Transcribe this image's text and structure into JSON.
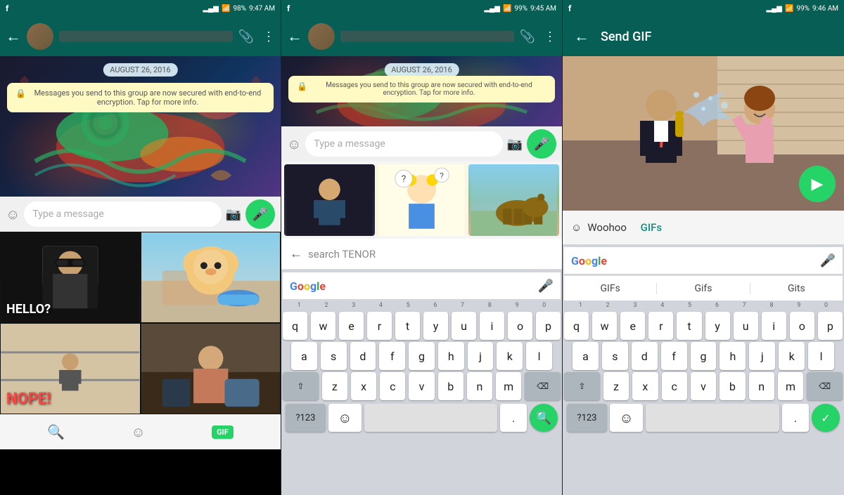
{
  "panels": [
    {
      "id": "panel1",
      "status": {
        "left": "f",
        "time": "9:47 AM",
        "battery": "98%",
        "signal": "▂▄▆"
      },
      "toolbar": {
        "back": "",
        "contact_name_placeholder": "████████████"
      },
      "chat": {
        "date_badge": "AUGUST 26, 2016",
        "system_message": "🔒 Messages you send to this group are now secured with end-to-end encryption. Tap for more info."
      },
      "input": {
        "placeholder": "Type a message"
      },
      "gif_cells": [
        {
          "label": "HELLO?",
          "style": "dark-man"
        },
        {
          "label": "",
          "style": "pom"
        },
        {
          "label": "NOPE!",
          "style": "nope"
        },
        {
          "label": "",
          "style": "woman"
        }
      ],
      "bottom_bar": {
        "search_icon": "🔍",
        "emoji_icon": "☺",
        "gif_label": "GIF"
      }
    },
    {
      "id": "panel2",
      "status": {
        "left": "f",
        "time": "9:45 AM",
        "battery": "99%"
      },
      "toolbar": {},
      "chat": {
        "date_badge": "AUGUST 26, 2016",
        "system_message": "🔒 Messages you send to this group are now secured with end-to-end encryption. Tap for more info."
      },
      "input": {
        "placeholder": "Type a message"
      },
      "tenor_search": {
        "placeholder": "search TENOR"
      },
      "keyboard": {
        "row1": [
          "q",
          "w",
          "e",
          "r",
          "t",
          "y",
          "u",
          "i",
          "o",
          "p"
        ],
        "row2": [
          "a",
          "s",
          "d",
          "f",
          "g",
          "h",
          "j",
          "k",
          "l"
        ],
        "row3": [
          "z",
          "x",
          "c",
          "v",
          "b",
          "n",
          "m"
        ],
        "num_label": "?123",
        "comma": ",",
        "period": ".",
        "num_row": [
          "1",
          "2",
          "3",
          "4",
          "5",
          "6",
          "7",
          "8",
          "9",
          "0"
        ]
      }
    },
    {
      "id": "panel3",
      "status": {
        "left": "f",
        "time": "9:46 AM",
        "battery": "99%"
      },
      "header": {
        "title": "Send GIF"
      },
      "woohoo": {
        "label": "Woohoo",
        "gifs_link": "GIFs"
      },
      "keyboard": {
        "suggestions": [
          "GIFs",
          "Gifs",
          "Gits"
        ],
        "row1": [
          "q",
          "w",
          "e",
          "r",
          "t",
          "y",
          "u",
          "i",
          "o",
          "p"
        ],
        "row2": [
          "a",
          "s",
          "d",
          "f",
          "g",
          "h",
          "j",
          "k",
          "l"
        ],
        "row3": [
          "z",
          "x",
          "c",
          "v",
          "b",
          "n",
          "m"
        ],
        "num_label": "?123",
        "num_row": [
          "1",
          "2",
          "3",
          "4",
          "5",
          "6",
          "7",
          "8",
          "9",
          "0"
        ]
      }
    }
  ],
  "icons": {
    "mic": "🎤",
    "camera": "📷",
    "paperclip": "📎",
    "more": "⋮",
    "back": "←",
    "emoji": "☺",
    "search": "🔍",
    "send": "▶",
    "check": "✓",
    "google_g": "G",
    "shift": "⇧",
    "backspace": "⌫"
  },
  "colors": {
    "whatsapp_green": "#075e54",
    "whatsapp_light_green": "#25d366",
    "chat_bg": "#e5ddd5"
  }
}
